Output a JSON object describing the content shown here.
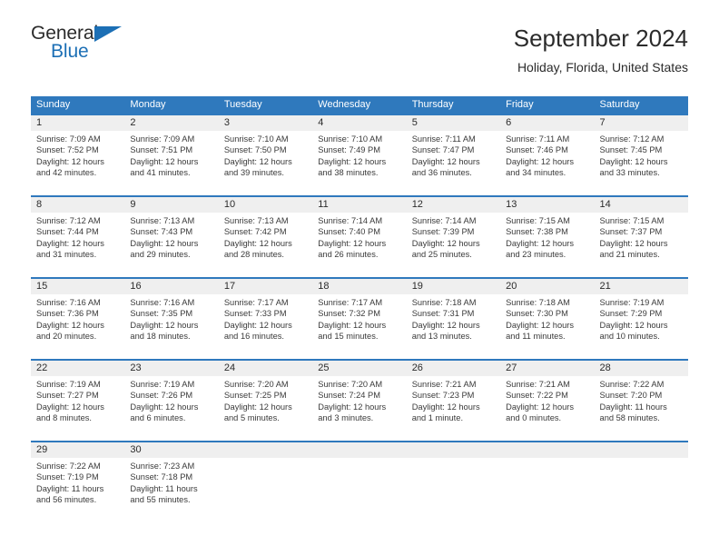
{
  "brand": {
    "name_part1": "General",
    "name_part2": "Blue",
    "color_dark": "#2b2b2b",
    "color_blue": "#1c6fb5"
  },
  "header": {
    "title": "September 2024",
    "subtitle": "Holiday, Florida, United States"
  },
  "theme": {
    "header_row_bg": "#2f79bd",
    "header_row_text": "#ffffff",
    "week_separator": "#2f79bd",
    "daynum_band_bg": "#efefef",
    "body_text": "#3a3a3a"
  },
  "calendar": {
    "columns": [
      "Sunday",
      "Monday",
      "Tuesday",
      "Wednesday",
      "Thursday",
      "Friday",
      "Saturday"
    ],
    "weeks": [
      [
        {
          "day": "1",
          "sunrise": "Sunrise: 7:09 AM",
          "sunset": "Sunset: 7:52 PM",
          "daylight_line1": "Daylight: 12 hours",
          "daylight_line2": "and 42 minutes."
        },
        {
          "day": "2",
          "sunrise": "Sunrise: 7:09 AM",
          "sunset": "Sunset: 7:51 PM",
          "daylight_line1": "Daylight: 12 hours",
          "daylight_line2": "and 41 minutes."
        },
        {
          "day": "3",
          "sunrise": "Sunrise: 7:10 AM",
          "sunset": "Sunset: 7:50 PM",
          "daylight_line1": "Daylight: 12 hours",
          "daylight_line2": "and 39 minutes."
        },
        {
          "day": "4",
          "sunrise": "Sunrise: 7:10 AM",
          "sunset": "Sunset: 7:49 PM",
          "daylight_line1": "Daylight: 12 hours",
          "daylight_line2": "and 38 minutes."
        },
        {
          "day": "5",
          "sunrise": "Sunrise: 7:11 AM",
          "sunset": "Sunset: 7:47 PM",
          "daylight_line1": "Daylight: 12 hours",
          "daylight_line2": "and 36 minutes."
        },
        {
          "day": "6",
          "sunrise": "Sunrise: 7:11 AM",
          "sunset": "Sunset: 7:46 PM",
          "daylight_line1": "Daylight: 12 hours",
          "daylight_line2": "and 34 minutes."
        },
        {
          "day": "7",
          "sunrise": "Sunrise: 7:12 AM",
          "sunset": "Sunset: 7:45 PM",
          "daylight_line1": "Daylight: 12 hours",
          "daylight_line2": "and 33 minutes."
        }
      ],
      [
        {
          "day": "8",
          "sunrise": "Sunrise: 7:12 AM",
          "sunset": "Sunset: 7:44 PM",
          "daylight_line1": "Daylight: 12 hours",
          "daylight_line2": "and 31 minutes."
        },
        {
          "day": "9",
          "sunrise": "Sunrise: 7:13 AM",
          "sunset": "Sunset: 7:43 PM",
          "daylight_line1": "Daylight: 12 hours",
          "daylight_line2": "and 29 minutes."
        },
        {
          "day": "10",
          "sunrise": "Sunrise: 7:13 AM",
          "sunset": "Sunset: 7:42 PM",
          "daylight_line1": "Daylight: 12 hours",
          "daylight_line2": "and 28 minutes."
        },
        {
          "day": "11",
          "sunrise": "Sunrise: 7:14 AM",
          "sunset": "Sunset: 7:40 PM",
          "daylight_line1": "Daylight: 12 hours",
          "daylight_line2": "and 26 minutes."
        },
        {
          "day": "12",
          "sunrise": "Sunrise: 7:14 AM",
          "sunset": "Sunset: 7:39 PM",
          "daylight_line1": "Daylight: 12 hours",
          "daylight_line2": "and 25 minutes."
        },
        {
          "day": "13",
          "sunrise": "Sunrise: 7:15 AM",
          "sunset": "Sunset: 7:38 PM",
          "daylight_line1": "Daylight: 12 hours",
          "daylight_line2": "and 23 minutes."
        },
        {
          "day": "14",
          "sunrise": "Sunrise: 7:15 AM",
          "sunset": "Sunset: 7:37 PM",
          "daylight_line1": "Daylight: 12 hours",
          "daylight_line2": "and 21 minutes."
        }
      ],
      [
        {
          "day": "15",
          "sunrise": "Sunrise: 7:16 AM",
          "sunset": "Sunset: 7:36 PM",
          "daylight_line1": "Daylight: 12 hours",
          "daylight_line2": "and 20 minutes."
        },
        {
          "day": "16",
          "sunrise": "Sunrise: 7:16 AM",
          "sunset": "Sunset: 7:35 PM",
          "daylight_line1": "Daylight: 12 hours",
          "daylight_line2": "and 18 minutes."
        },
        {
          "day": "17",
          "sunrise": "Sunrise: 7:17 AM",
          "sunset": "Sunset: 7:33 PM",
          "daylight_line1": "Daylight: 12 hours",
          "daylight_line2": "and 16 minutes."
        },
        {
          "day": "18",
          "sunrise": "Sunrise: 7:17 AM",
          "sunset": "Sunset: 7:32 PM",
          "daylight_line1": "Daylight: 12 hours",
          "daylight_line2": "and 15 minutes."
        },
        {
          "day": "19",
          "sunrise": "Sunrise: 7:18 AM",
          "sunset": "Sunset: 7:31 PM",
          "daylight_line1": "Daylight: 12 hours",
          "daylight_line2": "and 13 minutes."
        },
        {
          "day": "20",
          "sunrise": "Sunrise: 7:18 AM",
          "sunset": "Sunset: 7:30 PM",
          "daylight_line1": "Daylight: 12 hours",
          "daylight_line2": "and 11 minutes."
        },
        {
          "day": "21",
          "sunrise": "Sunrise: 7:19 AM",
          "sunset": "Sunset: 7:29 PM",
          "daylight_line1": "Daylight: 12 hours",
          "daylight_line2": "and 10 minutes."
        }
      ],
      [
        {
          "day": "22",
          "sunrise": "Sunrise: 7:19 AM",
          "sunset": "Sunset: 7:27 PM",
          "daylight_line1": "Daylight: 12 hours",
          "daylight_line2": "and 8 minutes."
        },
        {
          "day": "23",
          "sunrise": "Sunrise: 7:19 AM",
          "sunset": "Sunset: 7:26 PM",
          "daylight_line1": "Daylight: 12 hours",
          "daylight_line2": "and 6 minutes."
        },
        {
          "day": "24",
          "sunrise": "Sunrise: 7:20 AM",
          "sunset": "Sunset: 7:25 PM",
          "daylight_line1": "Daylight: 12 hours",
          "daylight_line2": "and 5 minutes."
        },
        {
          "day": "25",
          "sunrise": "Sunrise: 7:20 AM",
          "sunset": "Sunset: 7:24 PM",
          "daylight_line1": "Daylight: 12 hours",
          "daylight_line2": "and 3 minutes."
        },
        {
          "day": "26",
          "sunrise": "Sunrise: 7:21 AM",
          "sunset": "Sunset: 7:23 PM",
          "daylight_line1": "Daylight: 12 hours",
          "daylight_line2": "and 1 minute."
        },
        {
          "day": "27",
          "sunrise": "Sunrise: 7:21 AM",
          "sunset": "Sunset: 7:22 PM",
          "daylight_line1": "Daylight: 12 hours",
          "daylight_line2": "and 0 minutes."
        },
        {
          "day": "28",
          "sunrise": "Sunrise: 7:22 AM",
          "sunset": "Sunset: 7:20 PM",
          "daylight_line1": "Daylight: 11 hours",
          "daylight_line2": "and 58 minutes."
        }
      ],
      [
        {
          "day": "29",
          "sunrise": "Sunrise: 7:22 AM",
          "sunset": "Sunset: 7:19 PM",
          "daylight_line1": "Daylight: 11 hours",
          "daylight_line2": "and 56 minutes."
        },
        {
          "day": "30",
          "sunrise": "Sunrise: 7:23 AM",
          "sunset": "Sunset: 7:18 PM",
          "daylight_line1": "Daylight: 11 hours",
          "daylight_line2": "and 55 minutes."
        },
        {
          "day": "",
          "sunrise": "",
          "sunset": "",
          "daylight_line1": "",
          "daylight_line2": ""
        },
        {
          "day": "",
          "sunrise": "",
          "sunset": "",
          "daylight_line1": "",
          "daylight_line2": ""
        },
        {
          "day": "",
          "sunrise": "",
          "sunset": "",
          "daylight_line1": "",
          "daylight_line2": ""
        },
        {
          "day": "",
          "sunrise": "",
          "sunset": "",
          "daylight_line1": "",
          "daylight_line2": ""
        },
        {
          "day": "",
          "sunrise": "",
          "sunset": "",
          "daylight_line1": "",
          "daylight_line2": ""
        }
      ]
    ]
  }
}
